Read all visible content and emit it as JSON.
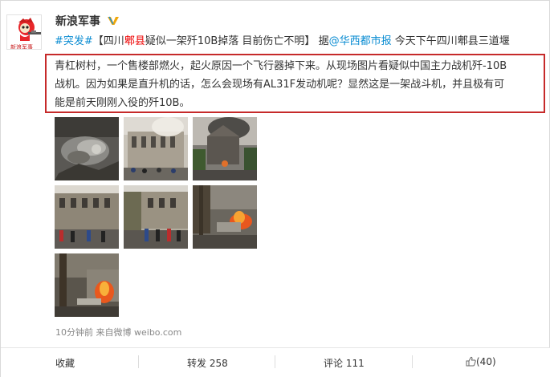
{
  "author": {
    "name": "新浪军事",
    "verified": true
  },
  "post": {
    "tag": "#突发#",
    "title_open": "【四川",
    "title_highlight": "郫县",
    "title_rest": "疑似一架歼10B掉落 目前伤亡不明】",
    "source_prefix": "据",
    "source_mention": "@华西都市报",
    "intro": "今天下午四川郫县三道堰",
    "quote_lines": [
      "青杠树村，一个售楼部燃火，起火原因一个飞行器掉下来。从现场图片看疑似中国主力战机歼-10B",
      "战机。因为如果是直升机的话，怎么会现场有AL31F发动机呢？显然这是一架战斗机，并且极有可",
      "能是前天刚刚入役的歼10B。"
    ]
  },
  "photos": [
    {
      "name": "wreckage-photo"
    },
    {
      "name": "building-smoke-photo"
    },
    {
      "name": "fire-smoke-photo"
    },
    {
      "name": "crowd-building-photo"
    },
    {
      "name": "crowd-street-photo"
    },
    {
      "name": "burning-vehicle-photo"
    },
    {
      "name": "burning-tree-photo"
    }
  ],
  "meta": {
    "time": "10分钟前",
    "source_label": "来自",
    "source_app": "微博 weibo.com"
  },
  "actions": {
    "favorite": "收藏",
    "repost": "转发 258",
    "comment": "评论 111",
    "like": "(40)"
  },
  "colors": {
    "link": "#0a8cd2",
    "highlight": "#e00000",
    "box_border": "#c62a2a"
  },
  "icons": [
    "verified-icon",
    "like-thumb-icon",
    "avatar-mascot-icon"
  ]
}
